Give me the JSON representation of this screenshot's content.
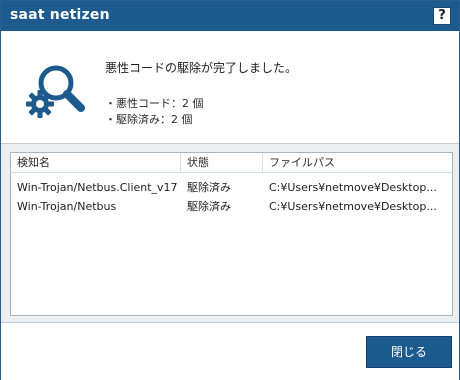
{
  "window": {
    "title": "saat netizen",
    "help_label": "?"
  },
  "result": {
    "message": "悪性コードの駆除が完了しました。",
    "malware_count_text": "・悪性コード：2 個",
    "removed_count_text": "・駆除済み：2 個"
  },
  "list": {
    "columns": [
      "検知名",
      "状態",
      "ファイルパス"
    ],
    "rows": [
      {
        "name": "Win-Trojan/Netbus.Client_v17",
        "status": "駆除済み",
        "path": "C:¥Users¥netmove¥Desktop..."
      },
      {
        "name": "Win-Trojan/Netbus",
        "status": "駆除済み",
        "path": "C:¥Users¥netmove¥Desktop..."
      }
    ]
  },
  "footer": {
    "close_label": "閉じる"
  },
  "colors": {
    "brand": "#1d5a8e",
    "icon": "#1d5a8e",
    "panel": "#eceff1"
  },
  "icons": {
    "scan": "magnifier-gear-icon"
  }
}
